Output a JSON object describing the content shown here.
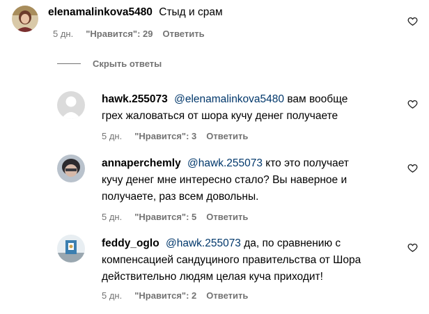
{
  "comments": [
    {
      "username": "elenamalinkova5480",
      "text": "Стыд и срам",
      "time": "5 дн.",
      "likes": "\"Нравится\": 29",
      "reply": "Ответить"
    }
  ],
  "hide_replies": "Скрыть ответы",
  "replies": [
    {
      "username": "hawk.255073",
      "mention": "@elenamalinkova5480",
      "line1": " вам вообще",
      "line2": "грех жаловаться от шора кучу денег получаете",
      "time": "5 дн.",
      "likes": "\"Нравится\": 3",
      "reply": "Ответить"
    },
    {
      "username": "annaperchemly",
      "mention": "@hawk.255073",
      "line1": " кто это получает",
      "line2": "кучу денег мне интересно стало? Вы наверное и",
      "line3": "получаете, раз всем довольны.",
      "time": "5 дн.",
      "likes": "\"Нравится\": 5",
      "reply": "Ответить"
    },
    {
      "username": "feddy_oglo",
      "mention": "@hawk.255073",
      "line1": " да, по сравнению с",
      "line2": "компенсацией сандуциного правительства от Шора",
      "line3": "действительно людям целая куча приходит!",
      "time": "5 дн.",
      "likes": "\"Нравится\": 2",
      "reply": "Ответить"
    }
  ],
  "icons": [
    "heart-icon",
    "default-avatar-icon"
  ]
}
